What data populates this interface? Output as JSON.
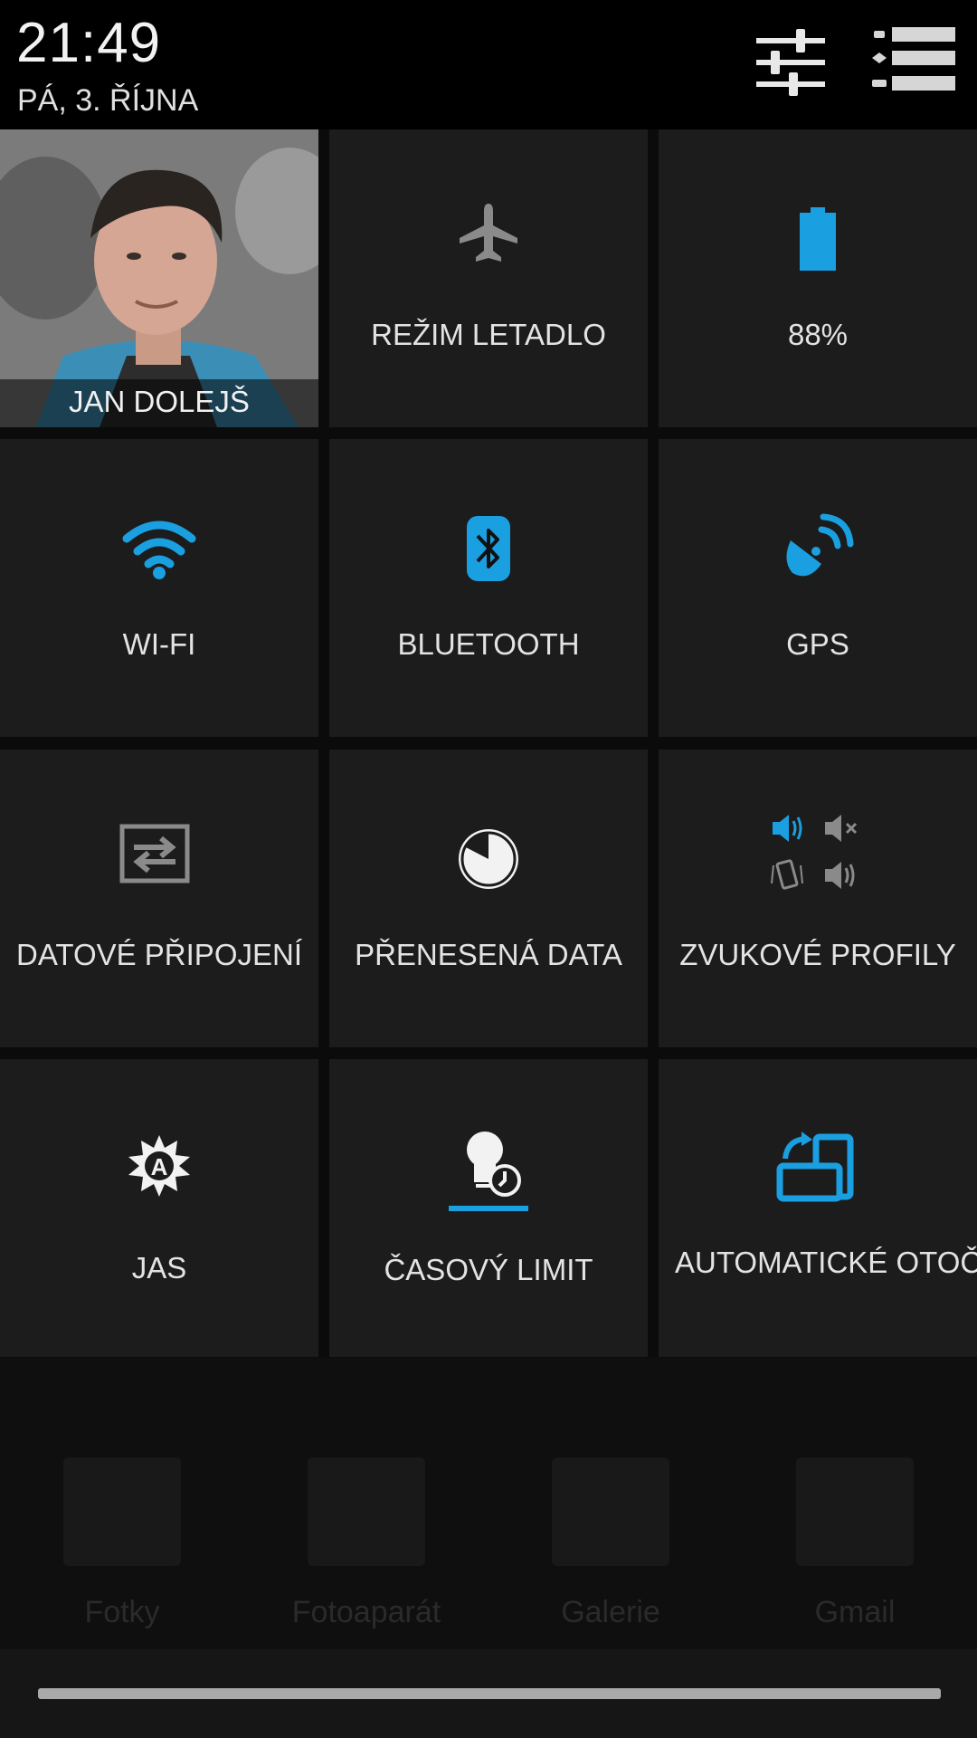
{
  "header": {
    "time": "21:49",
    "date": "PÁ, 3. ŘÍJNA",
    "settings_icon": "sliders-icon",
    "list_icon": "notification-list-icon"
  },
  "tiles": {
    "profile": {
      "name": "JAN DOLEJŠ",
      "icon": "avatar"
    },
    "airplane": {
      "label": "REŽIM LETADLO",
      "icon": "airplane-icon"
    },
    "battery": {
      "label": "88%",
      "icon": "battery-icon",
      "level": 0.88
    },
    "wifi": {
      "label": "WI-FI",
      "icon": "wifi-icon"
    },
    "bluetooth": {
      "label": "BLUETOOTH",
      "icon": "bluetooth-icon"
    },
    "gps": {
      "label": "GPS",
      "icon": "gps-icon"
    },
    "mobile_data": {
      "label": "DATOVÉ PŘIPOJENÍ",
      "icon": "data-transfer-icon"
    },
    "data_usage": {
      "label": "PŘENESENÁ DATA",
      "icon": "data-usage-icon"
    },
    "sound": {
      "label": "ZVUKOVÉ PROFILY",
      "icon": "sound-profiles-icon"
    },
    "brightness": {
      "label": "JAS",
      "icon": "auto-brightness-icon"
    },
    "timeout": {
      "label": "ČASOVÝ LIMIT",
      "icon": "screen-timeout-icon"
    },
    "rotate": {
      "label": "AUTOMATICKÉ OTOČENÍ",
      "icon": "auto-rotate-icon"
    }
  },
  "dock": {
    "apps": [
      {
        "label": "Fotky",
        "icon": "photos-icon"
      },
      {
        "label": "Fotoaparát",
        "icon": "camera-icon"
      },
      {
        "label": "Galerie",
        "icon": "gallery-icon"
      },
      {
        "label": "Gmail",
        "icon": "gmail-icon"
      }
    ]
  },
  "colors": {
    "accent": "#1a9fe0",
    "tile_bg": "#1c1c1c",
    "inactive_icon": "#8a8a8a"
  }
}
